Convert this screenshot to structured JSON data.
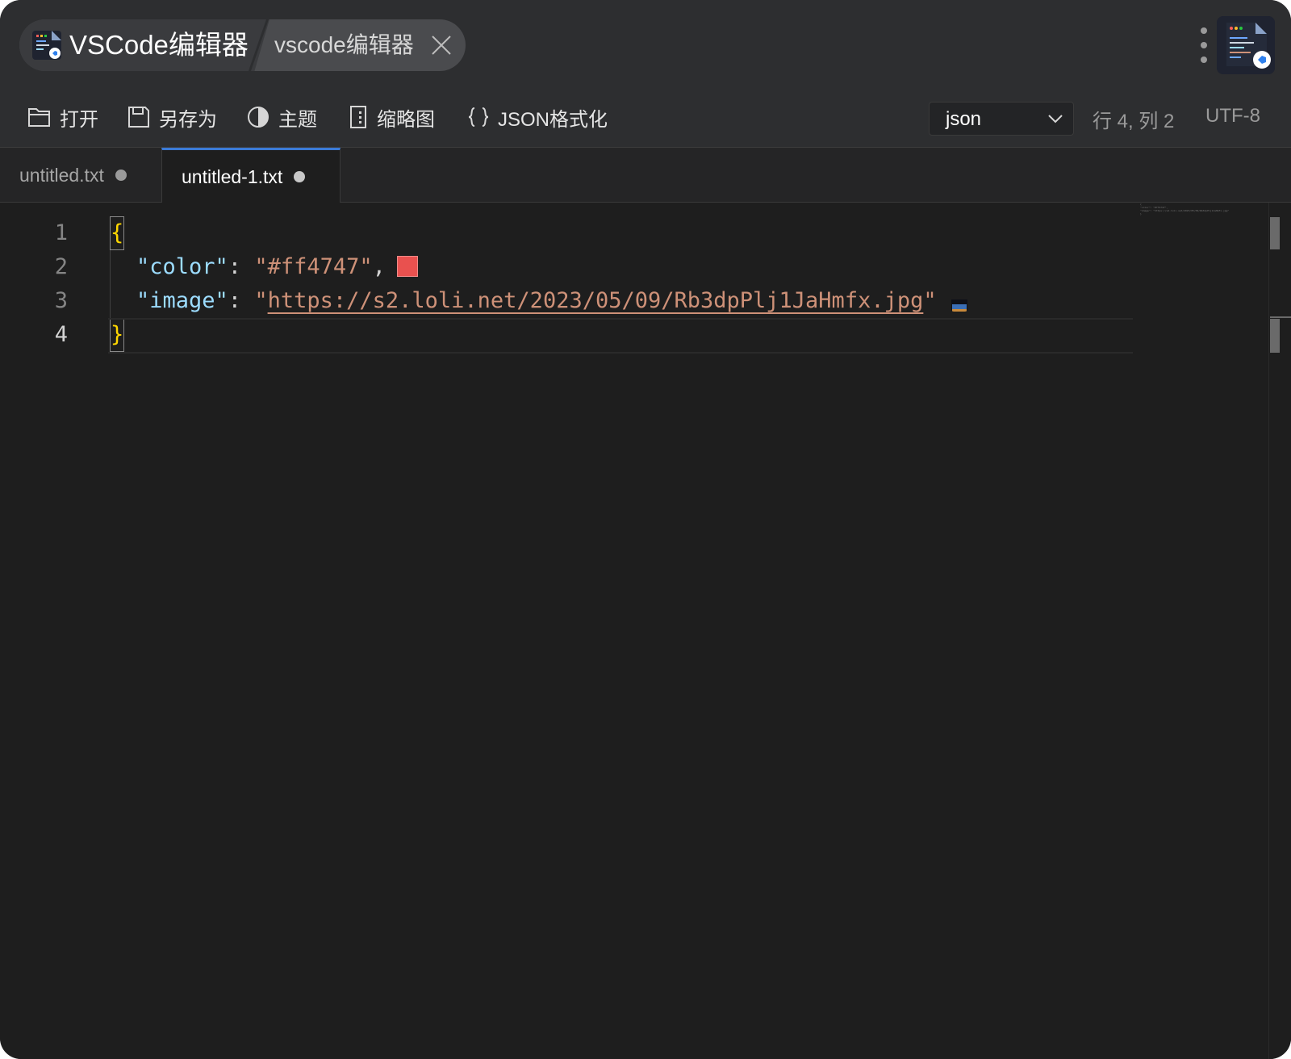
{
  "titlebar": {
    "app_title": "VSCode编辑器",
    "subtitle": "vscode编辑器",
    "close_icon": "close-icon",
    "more_icon": "more-vertical-icon",
    "app_icon": "vscode-app-icon"
  },
  "toolbar": {
    "open_label": "打开",
    "save_as_label": "另存为",
    "theme_label": "主题",
    "minimap_label": "缩略图",
    "json_format_label": "JSON格式化",
    "language": "json",
    "cursor_position": "行 4, 列 2",
    "encoding": "UTF-8"
  },
  "tabs": [
    {
      "label": "untitled.txt",
      "active": false,
      "modified": true
    },
    {
      "label": "untitled-1.txt",
      "active": true,
      "modified": true
    }
  ],
  "editor": {
    "line_numbers": [
      "1",
      "2",
      "3",
      "4"
    ],
    "current_line": 4,
    "open_brace": "{",
    "close_brace": "}",
    "line2": {
      "key": "\"color\"",
      "colon": ": ",
      "value": "\"#ff4747\"",
      "comma": ","
    },
    "line3": {
      "key": "\"image\"",
      "colon": ": ",
      "quote_open": "\"",
      "url": "https://s2.loli.net/2023/05/09/Rb3dpPlj1JaHmfx.jpg",
      "quote_close": "\""
    },
    "swatch_color": "#ff4747",
    "minimap_text": [
      "{",
      "  \"color\": \"#ff4747\",",
      "  \"image\": \"https://s2.loli.net/2023/05/09/Rb3dpPlj1JaHmfx.jpg\"",
      "}"
    ]
  },
  "colors": {
    "accent": "#3b7bd8",
    "background": "#1e1e1e",
    "key": "#9cdcfe",
    "string": "#ce9178",
    "brace": "#ffd700"
  }
}
